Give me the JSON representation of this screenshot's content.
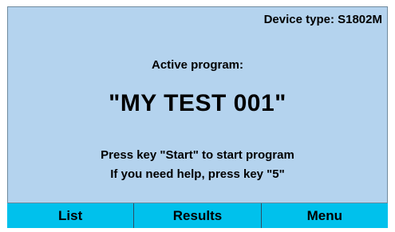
{
  "header": {
    "device_type": "Device type: S1802M"
  },
  "main": {
    "active_program_label": "Active program:",
    "program_name": "\"MY TEST 001\"",
    "hint_start": "Press key \"Start\" to start program",
    "hint_help": "If you need help, press key \"5\""
  },
  "softkeys": {
    "list_label": "List",
    "results_label": "Results",
    "menu_label": "Menu"
  },
  "colors": {
    "screen_background": "#b4d3ee",
    "softkey_background": "#00c1ec"
  }
}
